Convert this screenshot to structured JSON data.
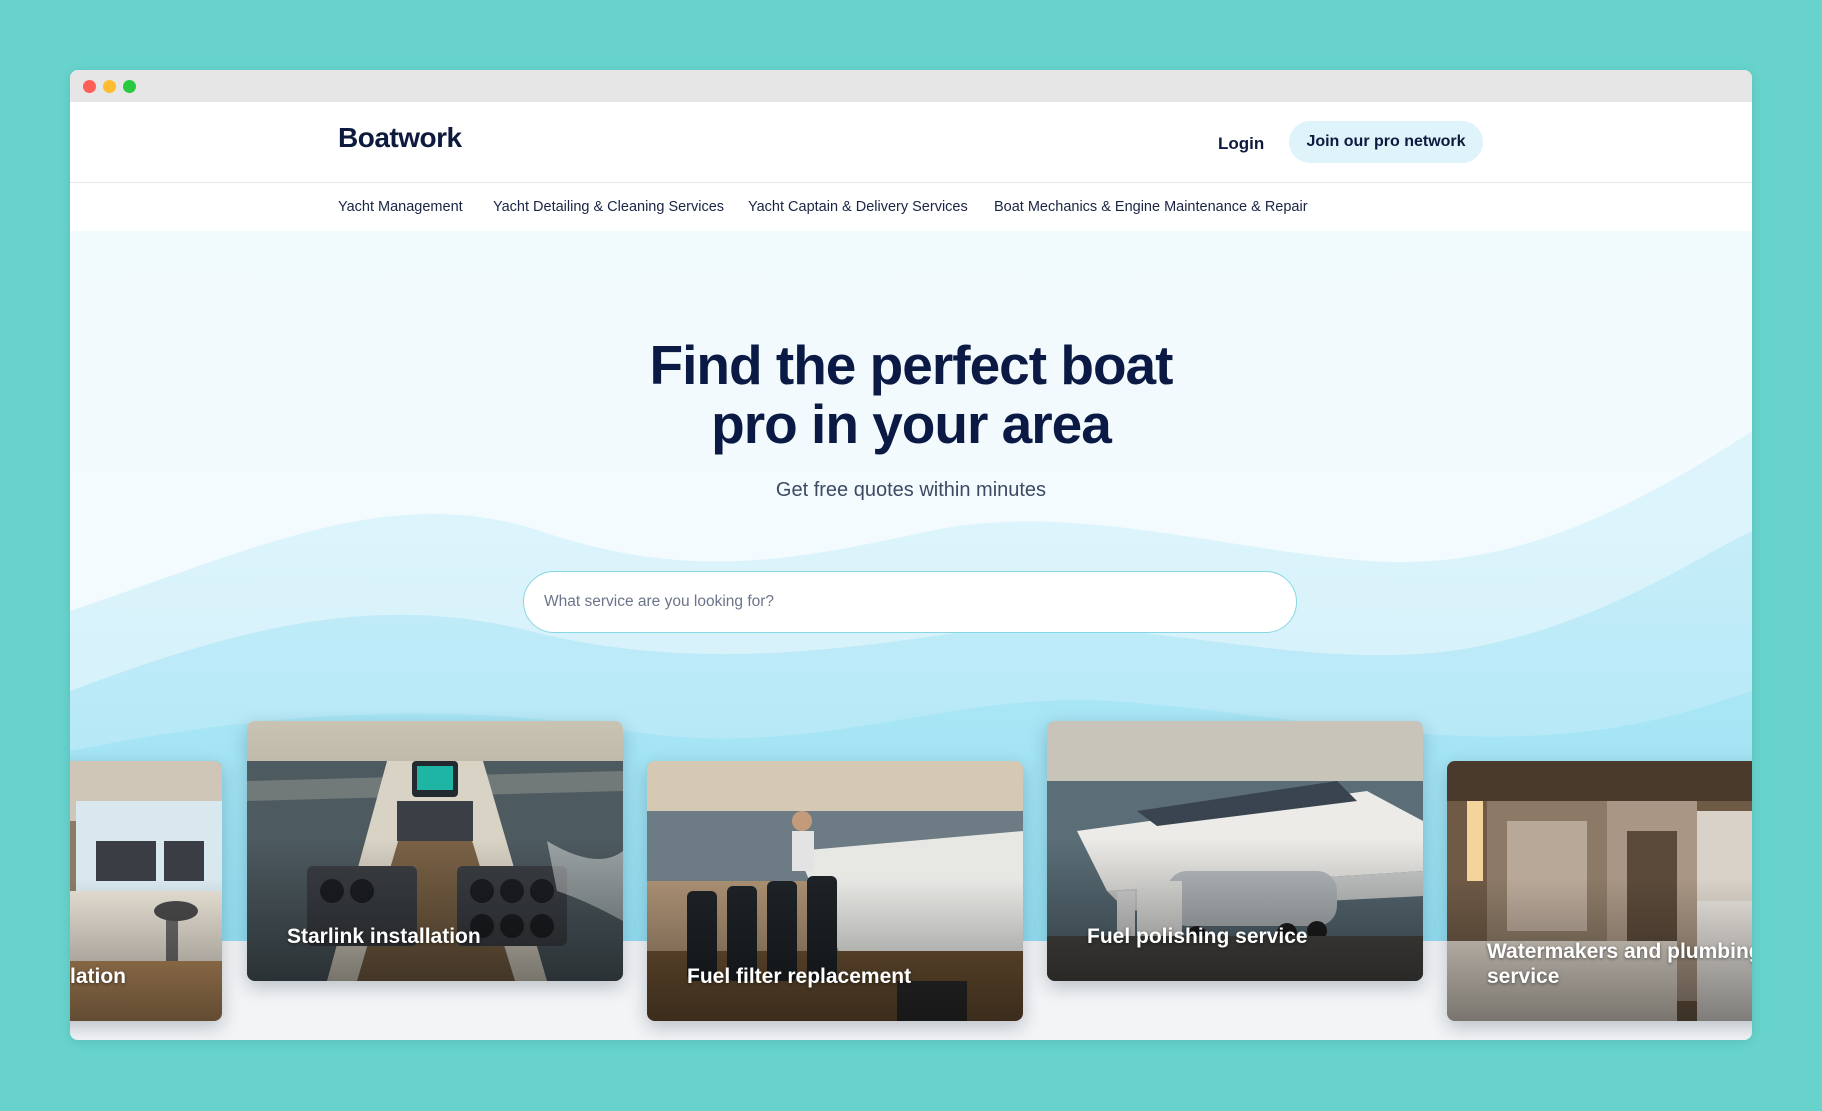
{
  "header": {
    "logo": "Boatwork",
    "login_label": "Login",
    "join_label": "Join our pro network"
  },
  "categories": [
    "Yacht Management",
    "Yacht Detailing & Cleaning Services",
    "Yacht Captain & Delivery Services",
    "Boat Mechanics & Engine Maintenance & Repair"
  ],
  "hero": {
    "title_line1": "Find the perfect boat",
    "title_line2": "pro in your area",
    "subtitle": "Get free quotes within minutes",
    "search_placeholder": "What service are you looking for?"
  },
  "services": [
    {
      "label": "lation"
    },
    {
      "label": "Starlink installation"
    },
    {
      "label": "Fuel filter replacement"
    },
    {
      "label": "Fuel polishing service"
    },
    {
      "label": "Watermakers and plumbing service"
    }
  ],
  "colors": {
    "page_bg": "#67d3cc",
    "brand_navy": "#0d1a3d",
    "join_button_bg": "#dff3fb",
    "search_border": "#86d7e3"
  }
}
